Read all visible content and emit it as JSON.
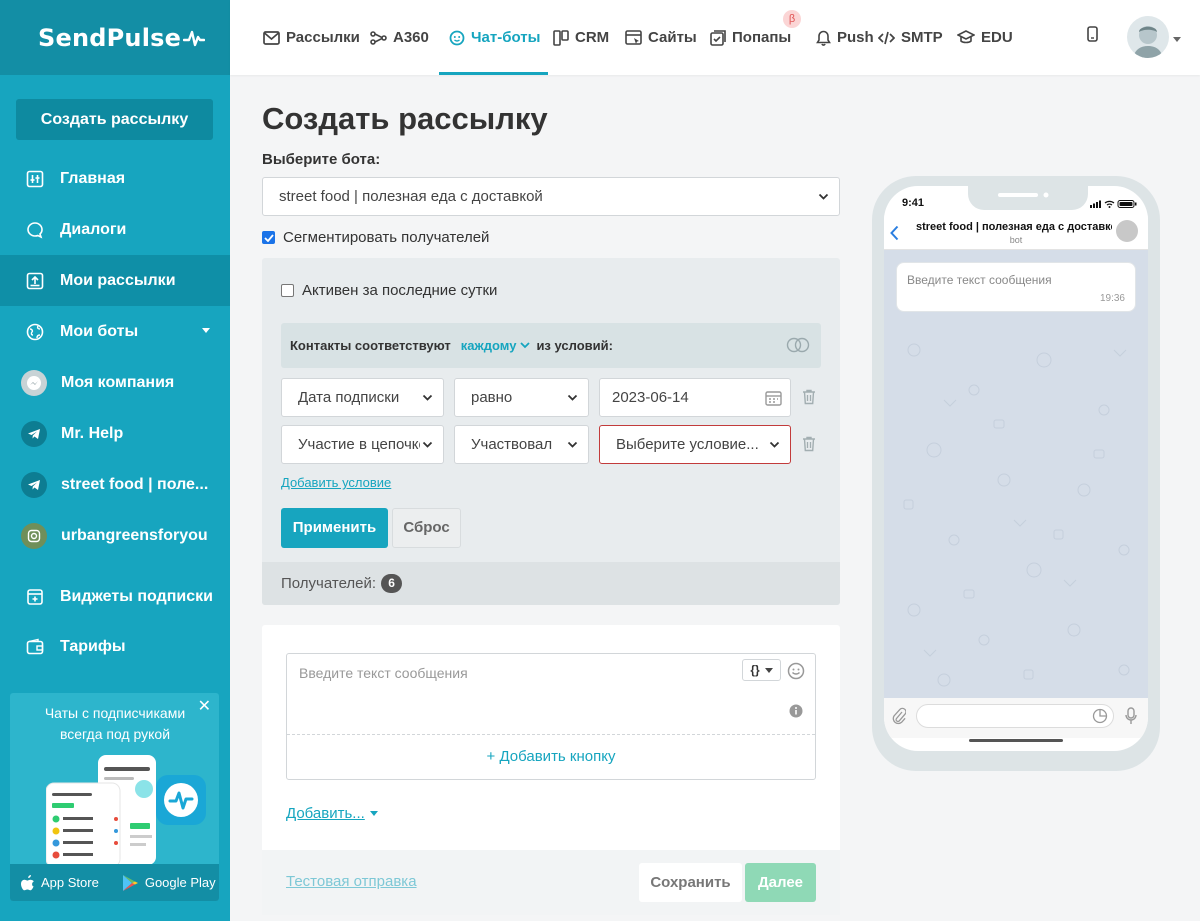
{
  "brand": {
    "name": "SendPulse",
    "accent": "#17a5bf",
    "sidebar_bg": "#17a5bf"
  },
  "sidebar": {
    "create_button": "Создать рассылку",
    "items": [
      {
        "label": "Главная",
        "icon": "home-icon"
      },
      {
        "label": "Диалоги",
        "icon": "chat-bubble-icon"
      },
      {
        "label": "Мои рассылки",
        "icon": "upload-tray-icon",
        "active": true
      },
      {
        "label": "Мои боты",
        "icon": "globe-icon",
        "has_submenu": true
      },
      {
        "label": "Моя компания",
        "icon": "messenger-icon"
      },
      {
        "label": "Mr. Help",
        "icon": "telegram-icon"
      },
      {
        "label": "street food | поле...",
        "icon": "telegram-icon"
      },
      {
        "label": "urbangreensforyou",
        "icon": "instagram-icon"
      },
      {
        "label": "Виджеты подписки",
        "icon": "widget-icon"
      },
      {
        "label": "Тарифы",
        "icon": "wallet-icon"
      }
    ],
    "promo": {
      "text": "Чаты с подписчиками всегда под рукой",
      "app_store": "App Store",
      "google_play": "Google Play"
    }
  },
  "topnav": {
    "items": [
      {
        "label": "Рассылки",
        "icon": "mail-icon"
      },
      {
        "label": "A360",
        "icon": "flow-icon"
      },
      {
        "label": "Чат-боты",
        "icon": "chatbot-icon",
        "active": true
      },
      {
        "label": "CRM",
        "icon": "crm-icon"
      },
      {
        "label": "Сайты",
        "icon": "site-icon"
      },
      {
        "label": "Попапы",
        "icon": "popup-icon",
        "badge": "β"
      },
      {
        "label": "Push",
        "icon": "bell-icon"
      },
      {
        "label": "SMTP",
        "icon": "code-icon"
      },
      {
        "label": "EDU",
        "icon": "graduation-cap-icon"
      }
    ]
  },
  "page": {
    "title": "Создать рассылку",
    "bot_label": "Выберите бота:",
    "bot_value": "street food | полезная еда с доставкой",
    "segment_checkbox": "Сегментировать получателей",
    "segment_checked": true,
    "active_checkbox": "Активен за последние сутки",
    "match": {
      "prefix": "Контакты соответствуют",
      "mode": "каждому",
      "suffix": "из условий:"
    },
    "conditions": [
      {
        "field": "Дата подписки",
        "operator": "равно",
        "value": "2023-06-14"
      },
      {
        "field": "Участие в цепочке",
        "operator": "Участвовал",
        "value": "Выберите условие..."
      }
    ],
    "add_condition": "Добавить условие",
    "apply": "Применить",
    "reset": "Сброс",
    "recipients_label": "Получателей:",
    "recipients_count": "6",
    "message_placeholder": "Введите текст сообщения",
    "var_button": "{}",
    "add_button": "+ Добавить кнопку",
    "add_more": "Добавить...",
    "test_send": "Тестовая отправка",
    "save": "Сохранить",
    "next": "Далее"
  },
  "preview": {
    "time": "9:41",
    "chat_title": "street food | полезная еда с доставкой",
    "chat_sub": "bot",
    "bubble_text": "Введите текст сообщения",
    "bubble_time": "19:36"
  }
}
